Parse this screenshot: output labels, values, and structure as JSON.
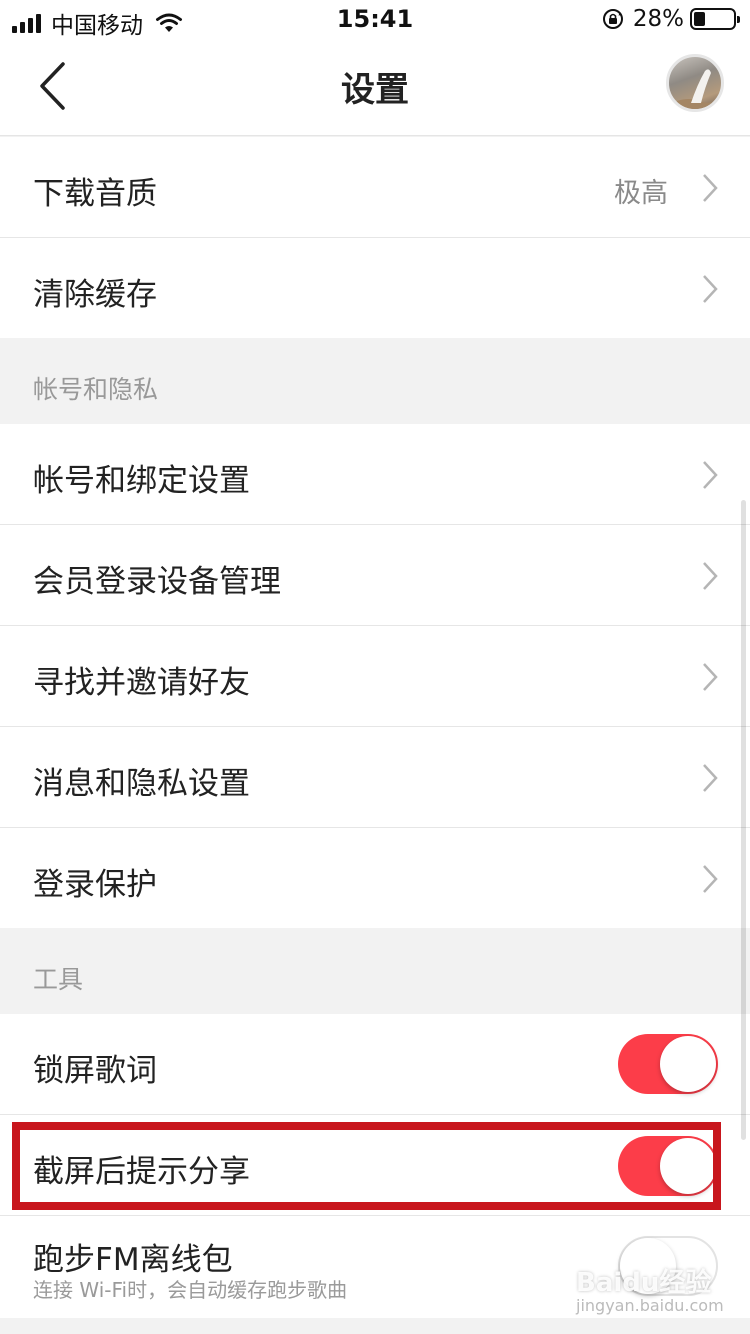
{
  "status_bar": {
    "carrier": "中国移动",
    "time": "15:41",
    "battery_percent": "28%",
    "battery_level": 0.28,
    "icons": [
      "signal-icon",
      "wifi-icon",
      "rotation-lock-icon",
      "battery-icon"
    ]
  },
  "nav": {
    "title": "设置",
    "back_icon": "chevron-left-icon",
    "avatar_icon": "user-avatar"
  },
  "rows_top": [
    {
      "label": "下载音质",
      "value": "极高"
    },
    {
      "label": "清除缓存",
      "value": ""
    }
  ],
  "section_account": {
    "title": "帐号和隐私",
    "items": [
      {
        "label": "帐号和绑定设置"
      },
      {
        "label": "会员登录设备管理"
      },
      {
        "label": "寻找并邀请好友"
      },
      {
        "label": "消息和隐私设置"
      },
      {
        "label": "登录保护"
      }
    ]
  },
  "section_tools": {
    "title": "工具",
    "items": [
      {
        "label": "锁屏歌词",
        "on": true
      },
      {
        "label": "截屏后提示分享",
        "on": true
      },
      {
        "label": "跑步FM离线包",
        "subtitle": "连接 Wi-Fi时，会自动缓存跑步歌曲",
        "on": false
      }
    ]
  },
  "watermark": {
    "text": "Baidu经验",
    "sub": "jingyan.baidu.com"
  },
  "colors": {
    "accent": "#fc3d49",
    "highlight": "#c8161d",
    "background": "#f2f2f2"
  }
}
